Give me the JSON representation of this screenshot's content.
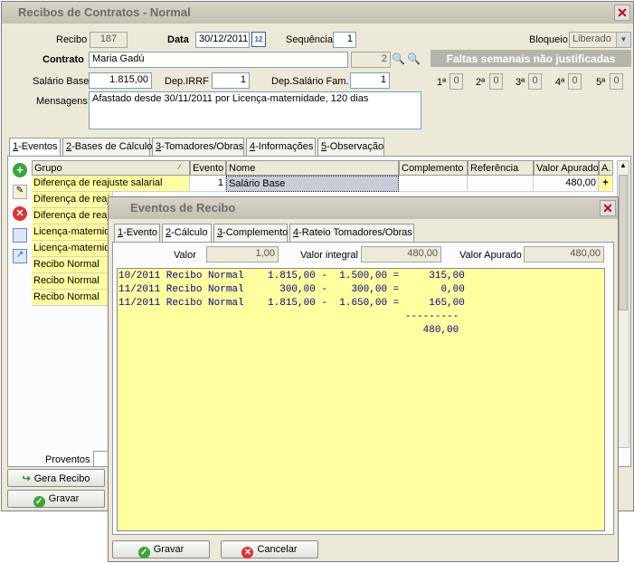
{
  "main": {
    "title": "Recibos de Contratos - Normal",
    "recibo_label": "Recibo",
    "recibo_value": "187",
    "data_label": "Data",
    "data_value": "30/12/2011",
    "sequencia_label": "Sequência",
    "sequencia_value": "1",
    "bloqueio_label": "Bloqueio",
    "bloqueio_value": "Liberado",
    "contrato_label": "Contrato",
    "contrato_value": "Maria Gadú",
    "contrato_num": "2",
    "faltas_header": "Faltas semanais não justificadas",
    "weeks": [
      {
        "label": "1ª",
        "value": "0"
      },
      {
        "label": "2ª",
        "value": "0"
      },
      {
        "label": "3ª",
        "value": "0"
      },
      {
        "label": "4ª",
        "value": "0"
      },
      {
        "label": "5ª",
        "value": "0"
      }
    ],
    "salario_label": "Salário Base",
    "salario_value": "1.815,00",
    "dep_irrf_label": "Dep.IRRF",
    "dep_irrf_value": "1",
    "dep_sal_label": "Dep.Salário Fam.",
    "dep_sal_value": "1",
    "mensagens_label": "Mensagens",
    "mensagens_value": "Afastado desde 30/11/2011 por Licença-maternidade, 120 dias",
    "tabs": [
      {
        "key": "1",
        "label": "-Eventos"
      },
      {
        "key": "2",
        "label": "-Bases de Cálculo"
      },
      {
        "key": "3",
        "label": "-Tomadores/Obras"
      },
      {
        "key": "4",
        "label": "-Informações"
      },
      {
        "key": "5",
        "label": "-Observação"
      }
    ],
    "columns": {
      "grupo": "Grupo",
      "evento": "Evento",
      "nome": "Nome",
      "complemento": "Complemento",
      "referencia": "Referência",
      "valor": "Valor Apurado",
      "extra": "A."
    },
    "rows": [
      {
        "grupo": "Diferença de reajuste salarial",
        "evento": "1",
        "nome": "Salário Base",
        "valor": "480,00",
        "mark": "+"
      },
      {
        "grupo": "Diferença de reajuste salarial"
      },
      {
        "grupo": "Diferença de reajuste salarial"
      },
      {
        "grupo": "Licença-maternidade"
      },
      {
        "grupo": "Licença-maternidade"
      },
      {
        "grupo": "Recibo Normal"
      },
      {
        "grupo": "Recibo Normal"
      },
      {
        "grupo": "Recibo Normal"
      }
    ],
    "proventos_label": "Proventos",
    "gera_recibo_label": "Gera Recibo",
    "gravar_label": "Gravar"
  },
  "dialog": {
    "title": "Eventos de Recibo",
    "tabs": [
      {
        "key": "1",
        "label": "-Evento"
      },
      {
        "key": "2",
        "label": "-Cálculo"
      },
      {
        "key": "3",
        "label": "-Complemento"
      },
      {
        "key": "4",
        "label": "-Rateio Tomadores/Obras"
      }
    ],
    "valor_label": "Valor",
    "valor_value": "1,00",
    "valor_integral_label": "Valor integral",
    "valor_integral_value": "480,00",
    "valor_apurado_label": "Valor Apurado",
    "valor_apurado_value": "480,00",
    "calc_lines": [
      "10/2011 Recibo Normal    1.815,00 -  1.500,00 =     315,00",
      "11/2011 Recibo Normal      300,00 -    300,00 =       0,00",
      "11/2011 Recibo Normal    1.815,00 -  1.650,00 =     165,00",
      "                                                ---------",
      "                                                   480,00"
    ],
    "gravar_label": "Gravar",
    "cancelar_label": "Cancelar"
  }
}
